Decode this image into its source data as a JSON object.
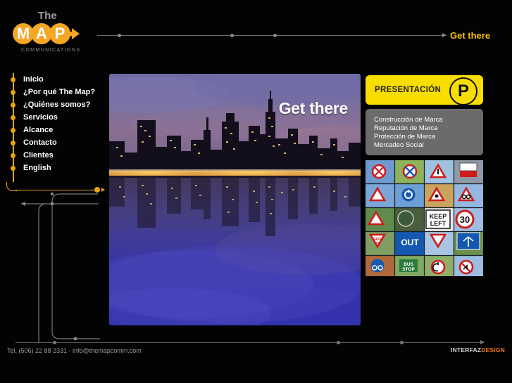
{
  "site": {
    "background_color": "#030303",
    "accent_orange": "#E8A317",
    "accent_yellow": "#F7DD00",
    "gold": "#F5C000"
  },
  "logo": {
    "the": "The",
    "letters": [
      "M",
      "A",
      "P"
    ],
    "tagline": "COMMUNICATIONS",
    "arrow_icon": "arrow-right-icon"
  },
  "header": {
    "rail_dots": [
      29,
      189,
      250
    ],
    "cta_label": "Get there",
    "cta_arrow_icon": "arrow-right-icon"
  },
  "nav": {
    "items": [
      {
        "label": "Inicio"
      },
      {
        "label": "¿Por qué The Map?"
      },
      {
        "label": "¿Quiénes somos?"
      },
      {
        "label": "Servicios"
      },
      {
        "label": "Alcance"
      },
      {
        "label": "Contacto"
      },
      {
        "label": "Clientes"
      },
      {
        "label": "English"
      }
    ]
  },
  "main": {
    "photo_alt": "city-skyline-night-reflection",
    "caption": "Get there"
  },
  "panel": {
    "title": "PRESENTACIÓN",
    "icon": "parking-p-circle-icon",
    "lines": [
      "Construcción de Marca",
      "Reputación de Marca",
      "Protección de Marca",
      "Mercadeo Social"
    ],
    "signs_alt": "road-signs-collage"
  },
  "footer": {
    "rail_dots": [
      53,
      456,
      546
    ],
    "contact": "Tel. (506) 22 88 2331 - info@themapcomm.com",
    "credit_primary": "INTERFAZ",
    "credit_accent": "DESIGN"
  }
}
